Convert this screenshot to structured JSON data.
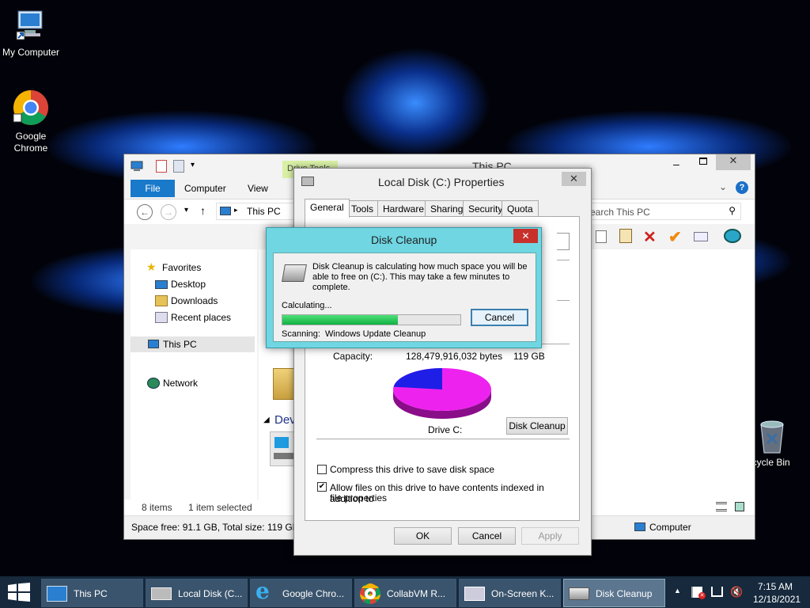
{
  "desktop": {
    "icons": [
      {
        "label": "My Computer"
      },
      {
        "label": "Google Chrome"
      },
      {
        "label": "ecycle Bin"
      }
    ]
  },
  "explorer": {
    "title": "This PC",
    "drive_tools": "Drive Tools",
    "ribbon_tabs": [
      "File",
      "Computer",
      "View"
    ],
    "address": "This PC",
    "search_placeholder": "earch This PC",
    "nav": {
      "favorites": "Favorites",
      "desktop": "Desktop",
      "downloads": "Downloads",
      "recent": "Recent places",
      "this_pc": "This PC",
      "network": "Network"
    },
    "dev_heading": "Dev",
    "status": {
      "items": "8 items",
      "selected": "1 item selected"
    },
    "footer": {
      "space": "Space free: 91.1 GB, Total size: 119 GB",
      "computer": "Computer"
    }
  },
  "properties": {
    "title": "Local Disk (C:) Properties",
    "tabs": [
      "General",
      "Tools",
      "Hardware",
      "Sharing",
      "Security",
      "Quota"
    ],
    "capacity_label": "Capacity:",
    "capacity_bytes": "128,479,916,032 bytes",
    "capacity_gb": "119 GB",
    "drive_label": "Drive C:",
    "disk_cleanup_btn": "Disk Cleanup",
    "compress": "Compress this drive to save disk space",
    "compress_checked": false,
    "index_line1": "Allow files on this drive to have contents indexed in addition to",
    "index_line2": "file properties",
    "index_checked": true,
    "ok": "OK",
    "cancel": "Cancel",
    "apply": "Apply",
    "pie": {
      "used_fraction": 0.23,
      "used_color": "#1e1ee6",
      "free_color": "#ee22ee"
    }
  },
  "cleanup": {
    "title": "Disk Cleanup",
    "msg1": "Disk Cleanup is calculating how much space you will be",
    "msg2": "able to free on  (C:). This may take a few minutes to",
    "msg3": "complete.",
    "calculating": "Calculating...",
    "progress": 0.65,
    "cancel": "Cancel",
    "scanning_label": "Scanning:",
    "scanning_item": "Windows Update Cleanup"
  },
  "taskbar": {
    "buttons": [
      "This PC",
      "Local Disk (C...",
      "Google Chro...",
      "CollabVM R...",
      "On-Screen K...",
      "Disk Cleanup"
    ],
    "time": "7:15 AM",
    "date": "12/18/2021",
    "colors": {
      "bar": "#16293d",
      "accent": "#2b8fd6"
    }
  }
}
